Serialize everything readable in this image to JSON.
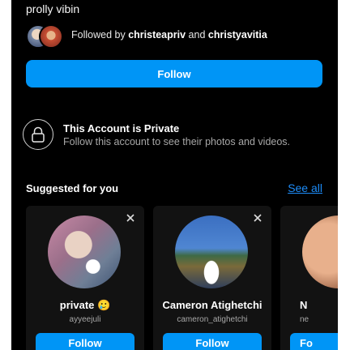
{
  "profile": {
    "bio": "prolly vibin",
    "followed_prefix": "Followed by",
    "followed_user1": "christeapriv",
    "followed_and": "and",
    "followed_user2": "christyavitia",
    "follow_label": "Follow"
  },
  "private_notice": {
    "title": "This Account is Private",
    "subtitle": "Follow this account to see their photos and videos."
  },
  "suggested": {
    "heading": "Suggested for you",
    "see_all": "See all",
    "cards": [
      {
        "name": "private 🥲",
        "handle": "ayyeejuli",
        "follow": "Follow"
      },
      {
        "name": "Cameron Atighetchi",
        "handle": "cameron_atighetchi",
        "follow": "Follow"
      },
      {
        "name": "N",
        "handle": "ne",
        "follow": "Fo"
      }
    ]
  },
  "colors": {
    "accent": "#0095f6",
    "link": "#1d8cf8",
    "background": "#000000"
  },
  "icons": {
    "close": "close-icon",
    "lock": "lock-icon"
  }
}
